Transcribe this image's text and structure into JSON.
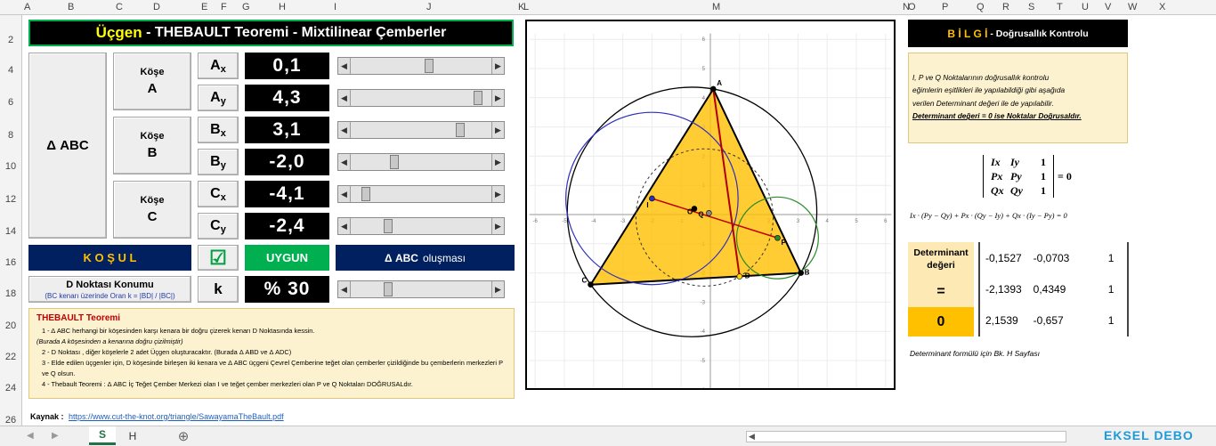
{
  "columns": [
    "A",
    "B",
    "C",
    "D",
    "E",
    "F",
    "G",
    "H",
    "I",
    "J",
    "K",
    "L",
    "M",
    "N",
    "O",
    "P",
    "Q",
    "R",
    "S",
    "T",
    "U",
    "V",
    "W",
    "X"
  ],
  "rows": [
    "2",
    "4",
    "6",
    "8",
    "10",
    "12",
    "14",
    "16",
    "18",
    "20",
    "22",
    "24",
    "26"
  ],
  "title": {
    "main": "Üçgen",
    "rest": " - THEBAULT Teoremi - Mixtilinear Çemberler"
  },
  "abc_label": "Δ ABC",
  "vertices": [
    {
      "kose": "Köşe",
      "letter": "A"
    },
    {
      "kose": "Köşe",
      "letter": "B"
    },
    {
      "kose": "Köşe",
      "letter": "C"
    }
  ],
  "params": [
    {
      "label": "A",
      "sub": "x",
      "value": "0,1",
      "thumb": 0.56
    },
    {
      "label": "A",
      "sub": "y",
      "value": "4,3",
      "thumb": 0.93
    },
    {
      "label": "B",
      "sub": "x",
      "value": "3,1",
      "thumb": 0.8
    },
    {
      "label": "B",
      "sub": "y",
      "value": "-2,0",
      "thumb": 0.3
    },
    {
      "label": "C",
      "sub": "x",
      "value": "-4,1",
      "thumb": 0.08
    },
    {
      "label": "C",
      "sub": "y",
      "value": "-2,4",
      "thumb": 0.25
    }
  ],
  "kosul": "K O Ş U L",
  "check_mark": "☑",
  "uygun": "UYGUN",
  "olusmasi": {
    "abc": "Δ ABC",
    "rest": "oluşması"
  },
  "d_noktasi": {
    "line1": "D Noktası Konumu",
    "line2": "(BC kenarı üzerinde  Oran k = |BD| / |BC|)"
  },
  "k_label": "k",
  "k_value": "% 30",
  "k_thumb": 0.25,
  "theorem": {
    "title": "THEBAULT Teoremi",
    "lines": [
      "1 - Δ ABC herhangi bir köşesinden karşı kenara bir doğru çizerek kenarı D Noktasında kessin.",
      "(Burada A köşesinden a kenarına doğru çizilmiştir)",
      "2 - D Noktası , diğer köşelerle 2 adet Üçgen oluşturacaktır. (Burada Δ ABD  ve Δ ADC)",
      "3 - Elde edilen üçgenler için, D köşesinde birleşen iki kenara ve Δ ABC üçgeni Çevrel Çemberine teğet olan çemberler çizildiğinde bu çemberlerin merkezleri P  ve  Q  olsun.",
      "4 - Thebault Teoremi : Δ ABC İç Teğet Çember Merkezi olan I ve teğet çember merkezleri olan P  ve  Q  Noktaları DOĞRUSALdır."
    ]
  },
  "kaynak": {
    "label": "Kaynak :",
    "url": "https://www.cut-the-knot.org/triangle/SawayamaTheBault.pdf"
  },
  "graph": {
    "points": {
      "A": [
        0.1,
        4.3
      ],
      "B": [
        3.1,
        -2.0
      ],
      "C": [
        -4.1,
        -2.4
      ],
      "D": [
        1.0,
        -2.12
      ]
    },
    "labels": [
      "A",
      "B",
      "C",
      "D",
      "I",
      "P",
      "Q",
      "O"
    ],
    "xticks": [
      "-6",
      "-5",
      "-4",
      "-3",
      "-2",
      "-1",
      "1",
      "2",
      "3",
      "4",
      "5",
      "6"
    ],
    "yticks": [
      "6",
      "5",
      "4",
      "3",
      "2",
      "1",
      "-1",
      "-2",
      "-3",
      "-4",
      "-5",
      "-6"
    ]
  },
  "bilgi": {
    "head": "B İ L G İ",
    "rest": " - Doğrusallık Kontrolu"
  },
  "info_lines": [
    "I, P  ve  Q Noktalarının doğrusallık kontrolu",
    "eğimlerin eşitlikleri ile yapılabildiği gibi aşağıda",
    "verilen Determinant değeri ile de yapılabilir."
  ],
  "info_bold": "Determinant değeri = 0 ise Noktalar Doğrusaldır.",
  "matrix": [
    [
      "Ix",
      "Iy",
      "1"
    ],
    [
      "Px",
      "Py",
      "1"
    ],
    [
      "Qx",
      "Qy",
      "1"
    ]
  ],
  "matrix_eq": "= 0",
  "formula": "Ix · (Py − Qy) + Px · (Qy − Iy) + Qx · (Iy − Py) = 0",
  "det_label": "Determinant değeri",
  "det_eq": "=",
  "det_zero": "0",
  "det_rows": [
    [
      "-0,1527",
      "-0,0703",
      "1"
    ],
    [
      "-2,1393",
      "0,4349",
      "1"
    ],
    [
      "2,1539",
      "-0,657",
      "1"
    ]
  ],
  "det_note": "Determinant formülü için Bk. H Sayfası",
  "tabs": [
    "S",
    "H"
  ],
  "add_tab": "⊕",
  "watermark": "EKSEL DEBO",
  "colors": {
    "accent_blue": "#002060",
    "green": "#00b050",
    "note_bg": "#fdf2d0",
    "triangle": "#ffc000"
  }
}
